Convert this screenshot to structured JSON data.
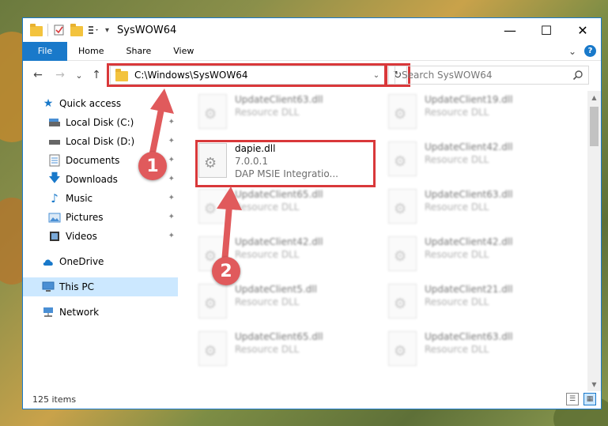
{
  "window": {
    "title": "SysWOW64",
    "minimize_glyph": "—",
    "maximize_glyph": "☐",
    "close_glyph": "✕"
  },
  "ribbon": {
    "tabs": [
      "File",
      "Home",
      "Share",
      "View"
    ],
    "help_glyph": "?",
    "expand_glyph": "⌄"
  },
  "nav": {
    "back_glyph": "←",
    "forward_glyph": "→",
    "recent_glyph": "⌄",
    "up_glyph": "↑",
    "address": "C:\\Windows\\SysWOW64",
    "dropdown_glyph": "⌄",
    "refresh_glyph": "↻",
    "search_placeholder": "Search SysWOW64"
  },
  "sidebar": {
    "items": [
      {
        "label": "Quick access",
        "icon": "star-icon"
      },
      {
        "label": "Local Disk (C:)",
        "icon": "drive-icon"
      },
      {
        "label": "Local Disk (D:)",
        "icon": "drive-icon"
      },
      {
        "label": "Documents",
        "icon": "document-icon"
      },
      {
        "label": "Downloads",
        "icon": "download-icon"
      },
      {
        "label": "Music",
        "icon": "music-icon"
      },
      {
        "label": "Pictures",
        "icon": "picture-icon"
      },
      {
        "label": "Videos",
        "icon": "video-icon"
      },
      {
        "label": "OneDrive",
        "icon": "cloud-icon"
      },
      {
        "label": "This PC",
        "icon": "computer-icon"
      },
      {
        "label": "Network",
        "icon": "network-icon"
      }
    ],
    "pin_glyph": "📌"
  },
  "files": {
    "left_col": [
      {
        "name": "UpdateClient63.dll",
        "sub": "Resource DLL"
      },
      {
        "name": "dapie.dll",
        "line2": "7.0.0.1",
        "line3": "DAP MSIE Integratio..."
      },
      {
        "name": "UpdateClient65.dll",
        "sub": "Resource DLL"
      },
      {
        "name": "UpdateClient42.dll",
        "sub": "Resource DLL"
      },
      {
        "name": "UpdateClient5.dll",
        "sub": "Resource DLL"
      },
      {
        "name": "UpdateClient65.dll",
        "sub": "Resource DLL"
      }
    ],
    "right_col": [
      {
        "name": "UpdateClient19.dll",
        "sub": "Resource DLL"
      },
      {
        "name": "UpdateClient42.dll",
        "sub": "Resource DLL"
      },
      {
        "name": "UpdateClient63.dll",
        "sub": "Resource DLL"
      },
      {
        "name": "UpdateClient42.dll",
        "sub": "Resource DLL"
      },
      {
        "name": "UpdateClient21.dll",
        "sub": "Resource DLL"
      },
      {
        "name": "UpdateClient63.dll",
        "sub": "Resource DLL"
      }
    ]
  },
  "status": {
    "items_count": "125 items"
  },
  "callouts": {
    "first": "1",
    "second": "2"
  },
  "colors": {
    "accent": "#1979ca",
    "highlight": "#d9383a",
    "callout": "#e05a5c",
    "selected": "#cce8ff"
  }
}
